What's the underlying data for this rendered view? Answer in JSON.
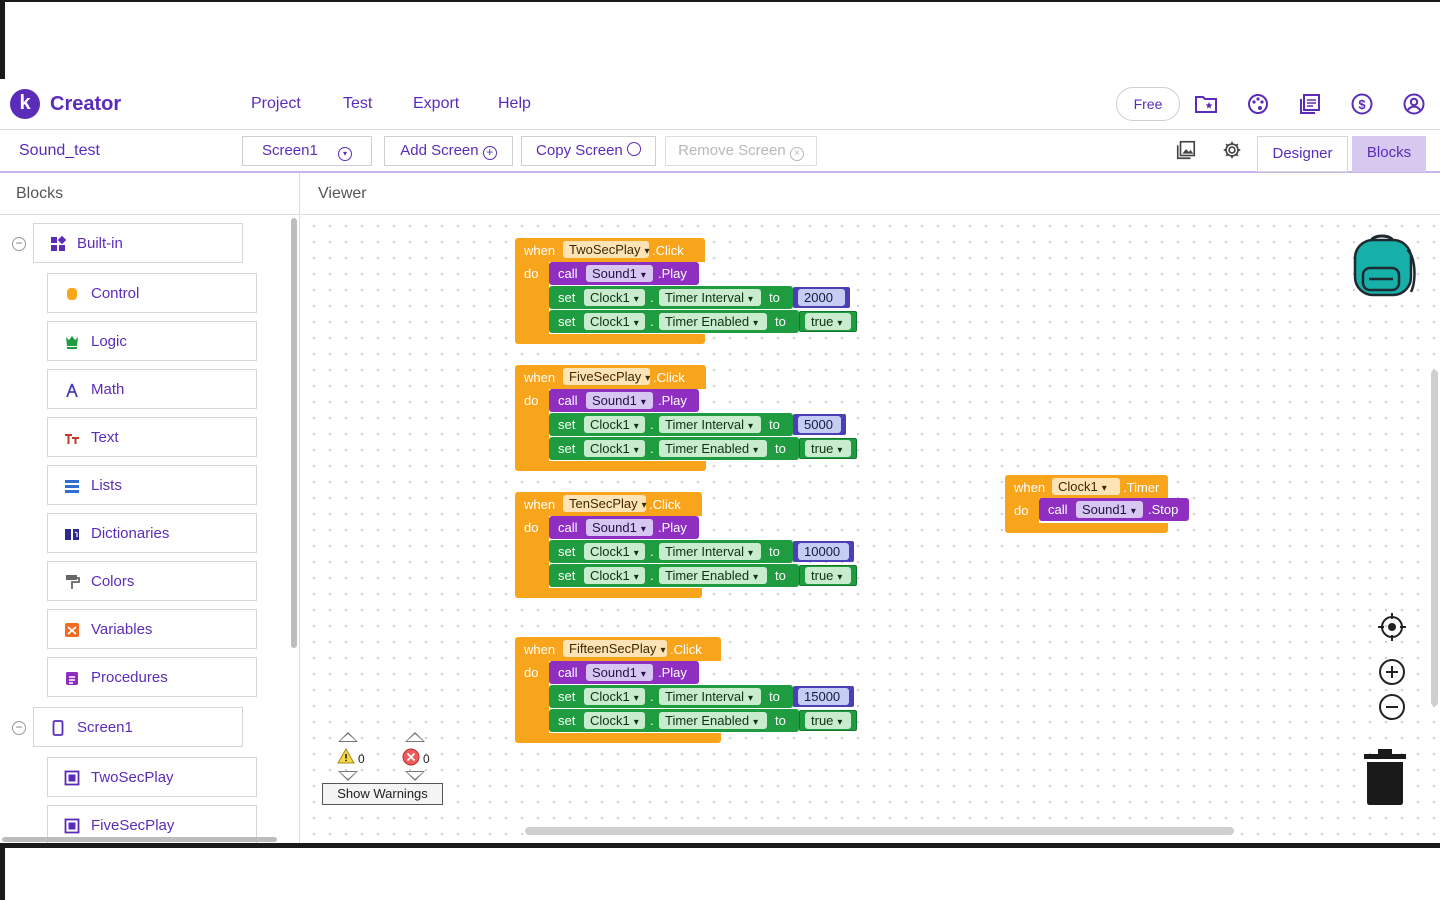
{
  "app": {
    "brand": "Creator",
    "logo_letter": "k",
    "accent": "#5b2cba"
  },
  "menu": [
    "Project",
    "Test",
    "Export",
    "Help"
  ],
  "header": {
    "plan_label": "Free"
  },
  "header_icons": [
    "folder-star-icon",
    "palette-icon",
    "library-icon",
    "dollar-icon",
    "account-icon"
  ],
  "toolbar": {
    "project_name": "Sound_test",
    "screen_select": "Screen1",
    "add_screen": "Add Screen",
    "copy_screen": "Copy Screen",
    "remove_screen": "Remove Screen",
    "designer": "Designer",
    "blocks": "Blocks"
  },
  "blocks_panel": {
    "title": "Blocks",
    "builtin": "Built-in",
    "builtin_items": [
      "Control",
      "Logic",
      "Math",
      "Text",
      "Lists",
      "Dictionaries",
      "Colors",
      "Variables",
      "Procedures"
    ],
    "screen": "Screen1",
    "screen_items": [
      "TwoSecPlay",
      "FiveSecPlay"
    ]
  },
  "viewer": {
    "title": "Viewer"
  },
  "keywords": {
    "when": "when",
    "do": "do",
    "call": "call",
    "set": "set",
    "to": "to",
    "dot": ".",
    "click": ".Click",
    "play": ".Play",
    "timer": ".Timer",
    "stop": ".Stop"
  },
  "events": [
    {
      "component": "TwoSecPlay",
      "sound": "Sound1",
      "clock": "Clock1",
      "interval_prop": "Timer Interval",
      "interval": "2000",
      "enabled_prop": "Timer Enabled",
      "enabled": "true"
    },
    {
      "component": "FiveSecPlay",
      "sound": "Sound1",
      "clock": "Clock1",
      "interval_prop": "Timer Interval",
      "interval": "5000",
      "enabled_prop": "Timer Enabled",
      "enabled": "true"
    },
    {
      "component": "TenSecPlay",
      "sound": "Sound1",
      "clock": "Clock1",
      "interval_prop": "Timer Interval",
      "interval": "10000",
      "enabled_prop": "Timer Enabled",
      "enabled": "true"
    },
    {
      "component": "FifteenSecPlay",
      "sound": "Sound1",
      "clock": "Clock1",
      "interval_prop": "Timer Interval",
      "interval": "15000",
      "enabled_prop": "Timer Enabled",
      "enabled": "true"
    }
  ],
  "timer_event": {
    "component": "Clock1",
    "sound": "Sound1"
  },
  "warnings": {
    "warning_count": "0",
    "error_count": "0",
    "button": "Show Warnings"
  },
  "colors": {
    "event": "#f9a51c",
    "call": "#8e2fc2",
    "set": "#1f9c40",
    "number": "#4a3fb6"
  }
}
